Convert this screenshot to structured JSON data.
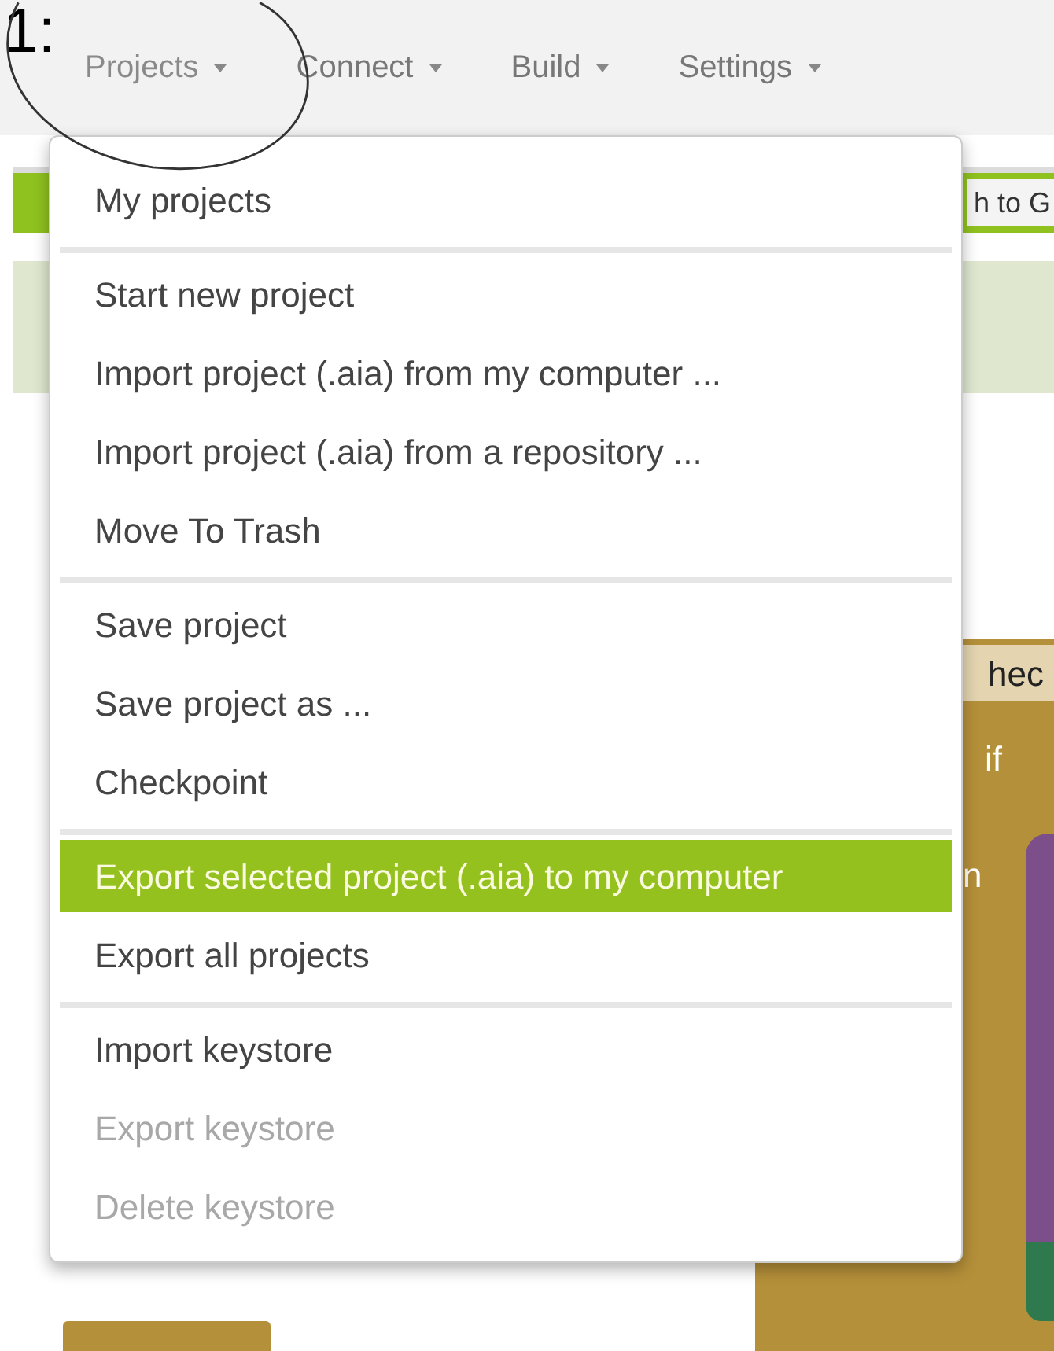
{
  "annotation": {
    "label": "1:"
  },
  "menu_bar": [
    {
      "label": "Projects",
      "selected": true
    },
    {
      "label": "Connect",
      "selected": false
    },
    {
      "label": "Build",
      "selected": false
    },
    {
      "label": "Settings",
      "selected": false
    }
  ],
  "background": {
    "toolbar_text": "h to G",
    "block_label": "hec",
    "block_if": "if",
    "block_then": "n"
  },
  "dropdown": {
    "groups": [
      [
        {
          "label": "My projects",
          "selected": false,
          "disabled": false
        }
      ],
      [
        {
          "label": "Start new project",
          "selected": false,
          "disabled": false
        },
        {
          "label": "Import project (.aia) from my computer ...",
          "selected": false,
          "disabled": false
        },
        {
          "label": "Import project (.aia) from a repository ...",
          "selected": false,
          "disabled": false
        },
        {
          "label": "Move To Trash",
          "selected": false,
          "disabled": false
        }
      ],
      [
        {
          "label": "Save project",
          "selected": false,
          "disabled": false
        },
        {
          "label": "Save project as ...",
          "selected": false,
          "disabled": false
        },
        {
          "label": "Checkpoint",
          "selected": false,
          "disabled": false
        }
      ],
      [
        {
          "label": "Export selected project (.aia) to my computer",
          "selected": true,
          "disabled": false
        },
        {
          "label": "Export all projects",
          "selected": false,
          "disabled": false
        }
      ],
      [
        {
          "label": "Import keystore",
          "selected": false,
          "disabled": false
        },
        {
          "label": "Export keystore",
          "selected": false,
          "disabled": true
        },
        {
          "label": "Delete keystore",
          "selected": false,
          "disabled": true
        }
      ]
    ]
  }
}
